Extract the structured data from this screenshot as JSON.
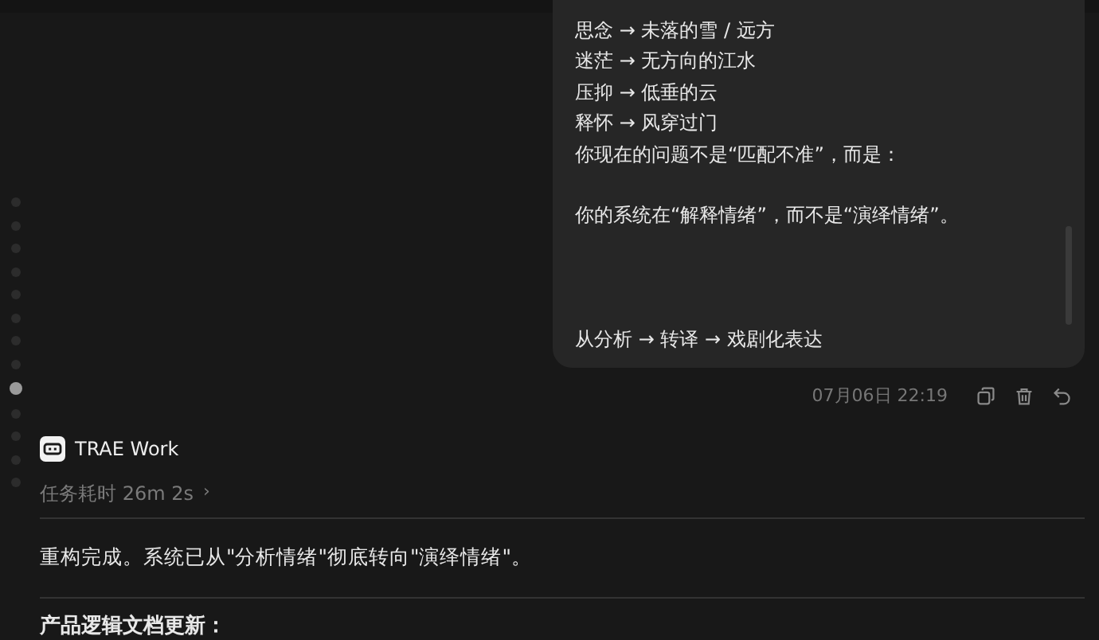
{
  "user_message": {
    "paragraphs": [
      [
        "思念 → 未落的雪 / 远方",
        "迷茫 → 无方向的江水",
        "压抑 → 低垂的云",
        "释怀 → 风穿过门",
        "你现在的问题不是“匹配不准”，而是："
      ],
      [
        "你的系统在“解释情绪”，而不是“演绎情绪”。"
      ],
      [
        "从分析 → 转译 → 戏剧化表达"
      ]
    ],
    "timestamp": "07月06日 22:19"
  },
  "timeline": [
    {
      "selected": false
    },
    {
      "selected": false
    },
    {
      "selected": false
    },
    {
      "selected": false
    },
    {
      "selected": false
    },
    {
      "selected": false
    },
    {
      "selected": false
    },
    {
      "selected": false
    },
    {
      "selected": true
    },
    {
      "selected": false
    },
    {
      "selected": false
    },
    {
      "selected": false
    },
    {
      "selected": false
    }
  ],
  "assistant": {
    "name": "TRAE Work",
    "duration": "任务耗时 26m 2s",
    "duration_chevron": "›",
    "summary": "重构完成。系统已从\"分析情绪\"彻底转向\"演绎情绪\"。",
    "heading": "产品逻辑文档更新："
  }
}
